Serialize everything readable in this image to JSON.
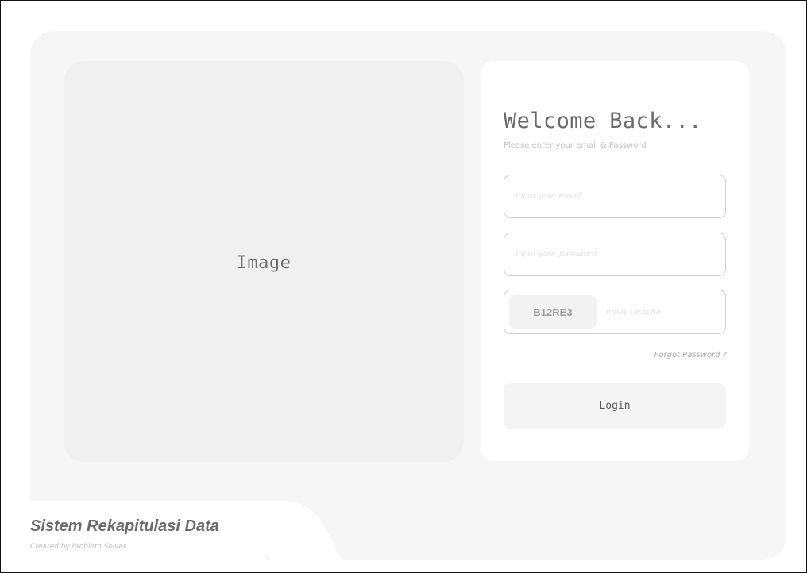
{
  "image_placeholder": {
    "label": "Image"
  },
  "login": {
    "title": "Welcome Back...",
    "subtitle": "Please enter your email & Password",
    "email_placeholder": "Input your email",
    "password_placeholder": "Input your password",
    "captcha_code": "B12RE3",
    "captcha_placeholder": "Input captcha",
    "forgot_label": "Forgot Password ?",
    "login_label": "Login"
  },
  "footer": {
    "brand": "Sistem Rekapitulasi Data",
    "credit": "Created by Problem Solver"
  },
  "colors": {
    "panel_bg": "#f6f6f6",
    "image_bg": "#f0f0f0",
    "card_bg": "#ffffff",
    "field_border": "#cfcfcf",
    "button_bg": "#f4f4f4",
    "text_dark": "#6a6a6a",
    "text_muted": "#c3c3c3"
  }
}
